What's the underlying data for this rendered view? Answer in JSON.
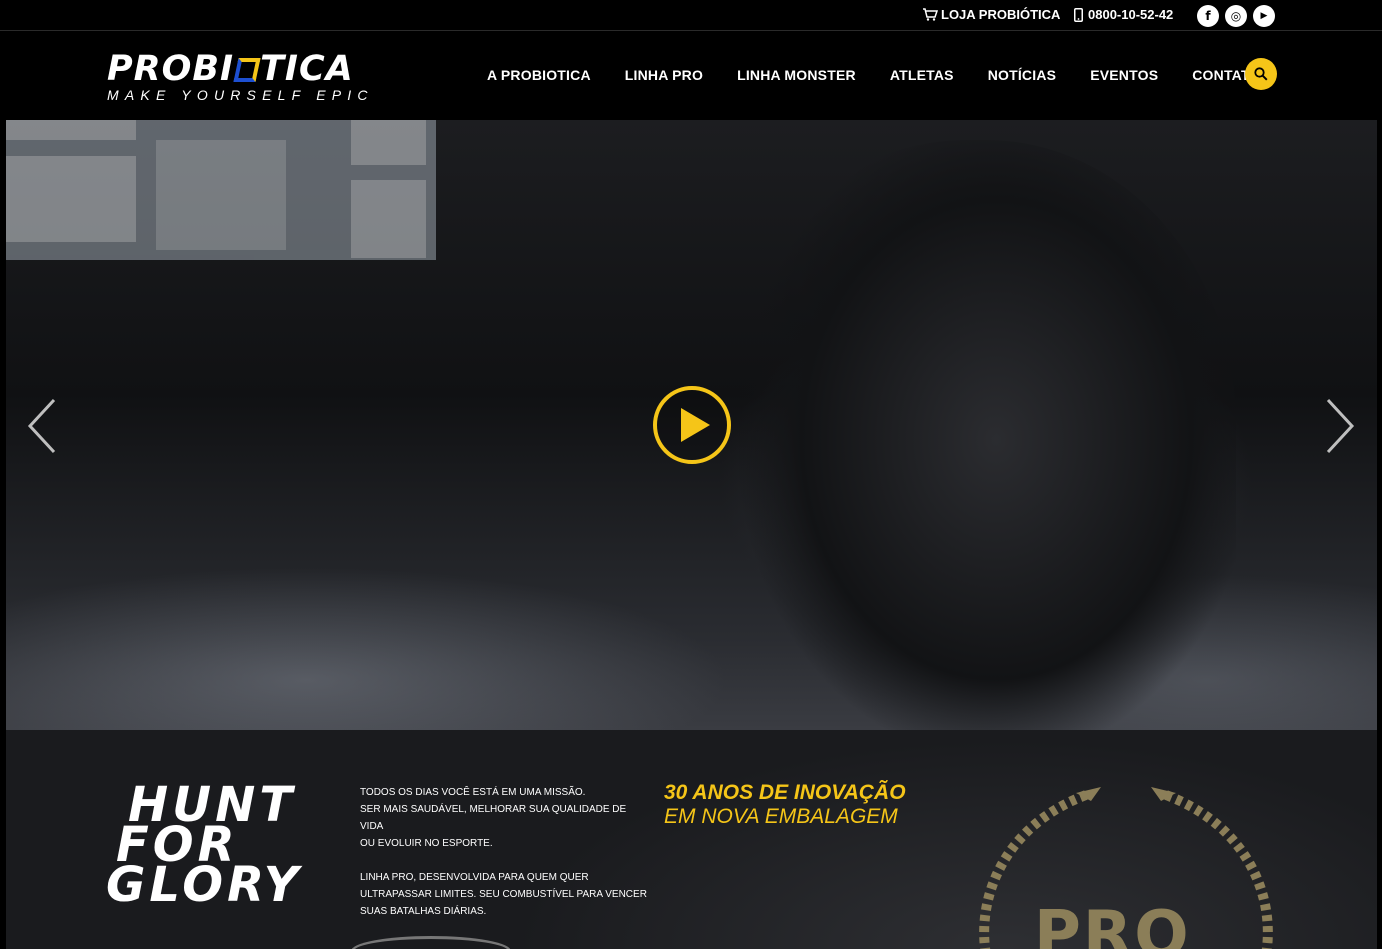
{
  "topbar": {
    "store_label": "LOJA PROBIÓTICA",
    "phone": "0800-10-52-42",
    "socials": [
      {
        "name": "facebook-icon",
        "glyph": "f"
      },
      {
        "name": "instagram-icon",
        "glyph": "◎"
      },
      {
        "name": "youtube-icon",
        "glyph": "▶"
      }
    ]
  },
  "header": {
    "logo_brand_left": "PROBI",
    "logo_brand_right": "TICA",
    "tagline": "MAKE YOURSELF EPIC",
    "nav": [
      {
        "label": "A PROBIOTICA"
      },
      {
        "label": "LINHA PRO"
      },
      {
        "label": "LINHA MONSTER"
      },
      {
        "label": "ATLETAS"
      },
      {
        "label": "NOTÍCIAS"
      },
      {
        "label": "EVENTOS"
      },
      {
        "label": "CONTATO"
      }
    ]
  },
  "hero": {
    "play_icon": "play-icon",
    "prev_icon": "chevron-left-icon",
    "next_icon": "chevron-right-icon"
  },
  "promo": {
    "headline": [
      "HUNT",
      "FOR",
      "GLORY"
    ],
    "paragraph1": [
      "TODOS OS DIAS VOCÊ ESTÁ EM UMA MISSÃO.",
      "SER MAIS SAUDÁVEL, MELHORAR SUA QUALIDADE DE VIDA",
      "OU EVOLUIR NO ESPORTE."
    ],
    "paragraph2": [
      "LINHA PRO, DESENVOLVIDA PARA QUEM QUER",
      "ULTRAPASSAR LIMITES. SEU COMBUSTÍVEL PARA VENCER",
      "SUAS BATALHAS DIÁRIAS."
    ],
    "innovation_line1": "30 ANOS DE INOVAÇÃO",
    "innovation_line2": "EM NOVA EMBALAGEM",
    "emblem_text": "PRO"
  },
  "colors": {
    "accent": "#f5c518",
    "brand_blue": "#1d4fd1",
    "background": "#000000"
  }
}
